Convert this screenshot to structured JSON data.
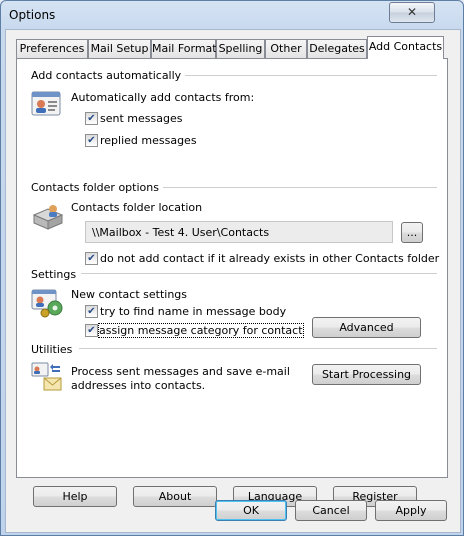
{
  "window": {
    "title": "Options",
    "close_glyph": "✕"
  },
  "tabs": [
    {
      "label": "Preferences"
    },
    {
      "label": "Mail Setup"
    },
    {
      "label": "Mail Format"
    },
    {
      "label": "Spelling"
    },
    {
      "label": "Other"
    },
    {
      "label": "Delegates"
    },
    {
      "label": "Add Contacts",
      "active": true
    }
  ],
  "add_auto": {
    "section": "Add contacts automatically",
    "intro": "Automatically add contacts from:",
    "sent": {
      "label": "sent messages",
      "checked": true
    },
    "replied": {
      "label": "replied messages",
      "checked": true
    }
  },
  "folder": {
    "section": "Contacts folder options",
    "location_label": "Contacts folder location",
    "path": "\\\\Mailbox - Test 4. User\\Contacts",
    "browse_label": "...",
    "no_dup": {
      "label": "do not add contact if it already exists in other Contacts folder",
      "checked": true
    }
  },
  "settings": {
    "section": "Settings",
    "new_label": "New contact settings",
    "find_name": {
      "label": "try to find name in message body",
      "checked": true
    },
    "assign_cat": {
      "label": "assign message category for contact",
      "checked": true
    },
    "advanced_label": "Advanced"
  },
  "utilities": {
    "section": "Utilities",
    "text_line1": "Process sent messages and save e-mail",
    "text_line2": "addresses into contacts.",
    "start_label": "Start Processing"
  },
  "bottom_buttons": {
    "help": "Help",
    "about": "About",
    "language": "Language",
    "register": "Register"
  },
  "dialog_buttons": {
    "ok": "OK",
    "cancel": "Cancel",
    "apply": "Apply"
  },
  "check_glyph": "✔"
}
